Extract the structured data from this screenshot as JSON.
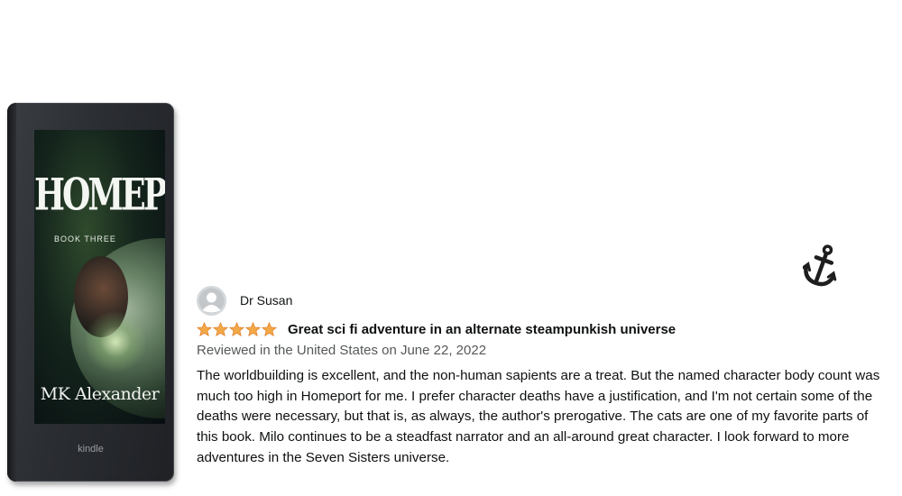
{
  "book": {
    "cover_title": "HOMEPORT",
    "cover_subtitle": "BOOK THREE",
    "cover_author": "MK Alexander",
    "device_brand": "kindle"
  },
  "icons": {
    "anchor": "anchor-icon",
    "avatar": "user-avatar-icon",
    "star": "star-icon"
  },
  "colors": {
    "star": "#f3a847",
    "meta_text": "#565959",
    "body_text": "#0f1111"
  },
  "review": {
    "reviewer": "Dr Susan",
    "rating": 5,
    "title": "Great sci fi adventure in an alternate steampunkish universe",
    "meta": "Reviewed in the United States on June 22, 2022",
    "body": "The worldbuilding is excellent, and the non-human sapients are a treat. But the named character body count was much too high in Homeport for me. I prefer character deaths have a justification, and I'm not certain some of the deaths were necessary, but that is, as always, the author's prerogative. The cats are one of my favorite parts of this book. Milo continues to be a steadfast narrator and an all-around great character. I look forward to more adventures in the Seven Sisters universe."
  }
}
